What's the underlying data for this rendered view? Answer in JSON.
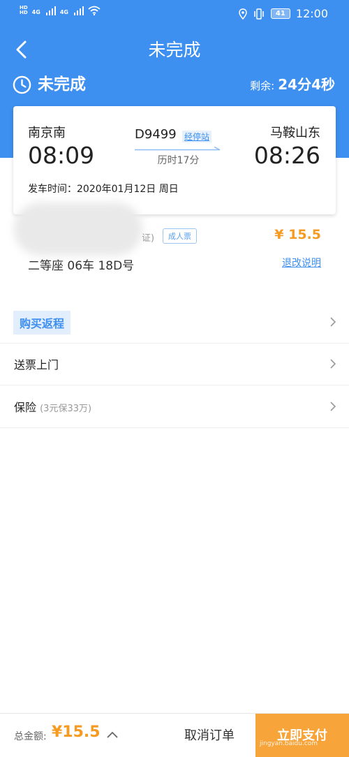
{
  "status_bar": {
    "sim1": "HD",
    "sim2": "HD",
    "net1": "4G",
    "net2": "4G",
    "battery": "41",
    "time": "12:00"
  },
  "header": {
    "title": "未完成"
  },
  "order_status": {
    "label": "未完成",
    "remaining_label": "剩余:",
    "remaining_value": "24分4秒"
  },
  "trip": {
    "from_station": "南京南",
    "from_time": "08:09",
    "to_station": "马鞍山东",
    "to_time": "08:26",
    "train_no": "D9499",
    "stops_link": "经停站",
    "duration": "历时17分",
    "depart_date": "发车时间：2020年01月12日 周日"
  },
  "passenger": {
    "id_type_tail": "证)",
    "ticket_type": "成人票",
    "price": "¥ 15.5",
    "seat": "二等座 06车 18D号",
    "refund_link": "退改说明"
  },
  "options": {
    "buy_return": "购买返程",
    "delivery": "送票上门",
    "insurance": "保险",
    "insurance_note": "(3元保33万)"
  },
  "bottom": {
    "total_label": "总金额:",
    "total_amount": "¥15.5",
    "cancel": "取消订单",
    "pay": "立即支付",
    "watermark": "jingyan.baidu.com"
  },
  "colors": {
    "primary": "#3d8ff0",
    "accent": "#f59b22",
    "pay_button": "#f7a43a"
  }
}
